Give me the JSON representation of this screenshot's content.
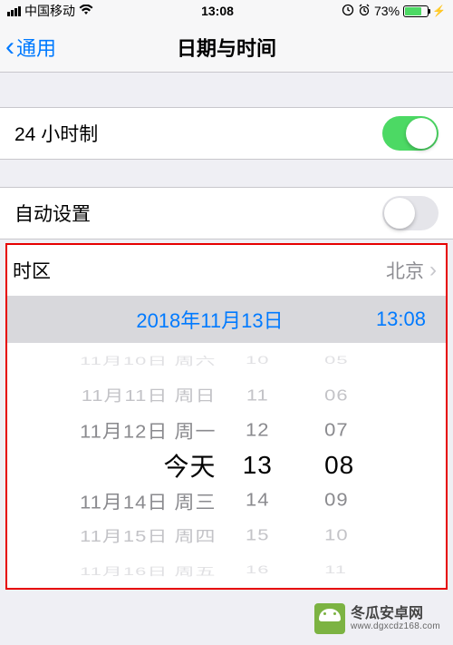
{
  "status": {
    "carrier": "中国移动",
    "time": "13:08",
    "battery_pct": "73%"
  },
  "nav": {
    "back_label": "通用",
    "title": "日期与时间"
  },
  "rows": {
    "format24_label": "24 小时制",
    "autoset_label": "自动设置",
    "timezone_label": "时区",
    "timezone_value": "北京",
    "selected_date": "2018年11月13日",
    "selected_time": "13:08"
  },
  "toggles": {
    "format24_on": true,
    "autoset_on": false
  },
  "picker": {
    "dates": [
      "11月10日 周六",
      "11月11日 周日",
      "11月12日 周一",
      "今天",
      "11月14日 周三",
      "11月15日 周四",
      "11月16日 周五"
    ],
    "hours": [
      "10",
      "11",
      "12",
      "13",
      "14",
      "15",
      "16"
    ],
    "minutes": [
      "05",
      "06",
      "07",
      "08",
      "09",
      "10",
      "11"
    ]
  },
  "watermark": {
    "name": "冬瓜安卓网",
    "url": "www.dgxcdz168.com"
  }
}
